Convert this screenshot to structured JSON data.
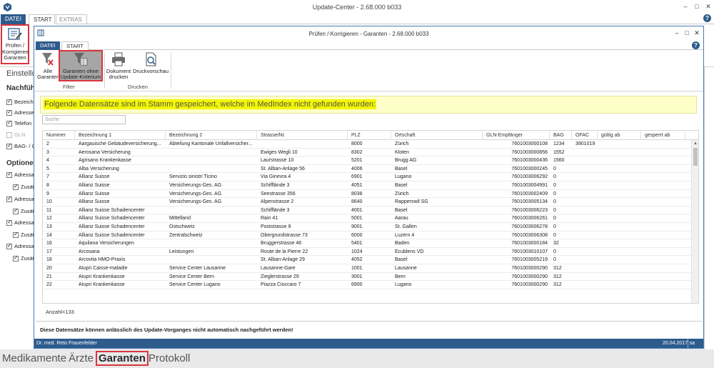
{
  "outer": {
    "title": "Update-Center - 2.68.000 b033",
    "tabs": [
      "DATEI",
      "START",
      "EXTRAS"
    ],
    "ribbon_button_label": "Prüfen / Korrigieren Garanten",
    "help": "?",
    "win_controls": [
      "–",
      "□",
      "✕"
    ]
  },
  "left_panel": {
    "heading1": "Einstellu",
    "heading2": "Nachfüh",
    "items1": [
      {
        "label": "Bezeichn",
        "checked": true,
        "disabled": false
      },
      {
        "label": "Adresse",
        "checked": true,
        "disabled": false
      },
      {
        "label": "Telefon",
        "checked": true,
        "disabled": false
      },
      {
        "label": "GLN",
        "checked": false,
        "disabled": true
      },
      {
        "label": "BAG- / C",
        "checked": true,
        "disabled": false
      }
    ],
    "heading3": "Optione",
    "items2": [
      {
        "label": "Adressal",
        "checked": true,
        "indent": false
      },
      {
        "label": "Zusät",
        "checked": true,
        "indent": true
      },
      {
        "label": "Adressal",
        "checked": true,
        "indent": false
      },
      {
        "label": "Zusät",
        "checked": true,
        "indent": true
      },
      {
        "label": "Adressal",
        "checked": true,
        "indent": false
      },
      {
        "label": "Zusät",
        "checked": true,
        "indent": true
      },
      {
        "label": "Adressal",
        "checked": true,
        "indent": false
      },
      {
        "label": "Zusät",
        "checked": true,
        "indent": true
      }
    ]
  },
  "dialog": {
    "title": "Prüfen / Korrigieren - Garanten - 2.68.000 b033",
    "tabs": [
      "DATEI",
      "START"
    ],
    "help": "?",
    "win_controls": [
      "–",
      "□",
      "✕"
    ],
    "ribbon": {
      "alle_garanten": "Alle Garanten",
      "ohne_update": "Garanten ohne Update-Kriterium",
      "dokument_drucken": "Dokument drucken",
      "druckvorschau": "Druckvorschau",
      "group_filter": "Filter",
      "group_drucken": "Drucken"
    },
    "notice": "Folgende Datensätze sind im Stamm gespeichert, welche im MedIndex nicht gefunden wurden:",
    "search_placeholder": "Suche",
    "columns": [
      "Nummer",
      "Bezeichnung 1",
      "Bezeichnung 2",
      "Strasse/Nr.",
      "PLZ",
      "Ortschaft",
      "GLN-Empfänger",
      "BAG",
      "OFAC",
      "gültig ab",
      "gesperrt ab"
    ],
    "rows": [
      [
        "2",
        "Aargauische Gebäudeversicherung...",
        "Abteilung Kantonale Unfallversicher...",
        "",
        "8000",
        "Zürich",
        "7601003000108",
        "1234",
        "3901019",
        "",
        ""
      ],
      [
        "3",
        "Aerosana Versicherung",
        "",
        "Ewiges Wegli 10",
        "8302",
        "Kloten",
        "7601003000856",
        "1552",
        "",
        "",
        ""
      ],
      [
        "4",
        "Agrisano Krankenkasse",
        "",
        "Laurstrasse 10",
        "5201",
        "Brugg AG",
        "7601003000436",
        "1560",
        "",
        "",
        ""
      ],
      [
        "5",
        "Alba Versicherung",
        "",
        "St. Alban-Anlage 56",
        "4006",
        "Basel",
        "7601003000245",
        "0",
        "",
        "",
        ""
      ],
      [
        "7",
        "Allianz Suisse",
        "Servizio sinistri Ticino",
        "Via Ginevra 4",
        "6901",
        "Lugano",
        "7601003006292",
        "0",
        "",
        "",
        ""
      ],
      [
        "8",
        "Allianz Suisse",
        "Versicherungs-Ges. AG",
        "Schifflände 3",
        "4051",
        "Basel",
        "7601003004991",
        "0",
        "",
        "",
        ""
      ],
      [
        "9",
        "Allianz Suisse",
        "Versicherungs-Ges. AG",
        "Seestrasse 356",
        "8038",
        "Zürich",
        "7601003002409",
        "0",
        "",
        "",
        ""
      ],
      [
        "10",
        "Allianz Suisse",
        "Versicherungs-Ges. AG",
        "Alpenstrasse 2",
        "8640",
        "Rapperswil SG",
        "7601003005134",
        "0",
        "",
        "",
        ""
      ],
      [
        "11",
        "Allianz Suisse Schadencenter",
        "",
        "Schifflände 3",
        "4001",
        "Basel",
        "7601003006223",
        "0",
        "",
        "",
        ""
      ],
      [
        "12",
        "Allianz Suisse Schadencenter",
        "Mittelland",
        "Rain 41",
        "5001",
        "Aarau",
        "7601003006261",
        "0",
        "",
        "",
        ""
      ],
      [
        "13",
        "Allianz Suisse Schadencenter",
        "Ostschweiz",
        "Poststrasse 9",
        "9001",
        "St. Gallen",
        "7601003006278",
        "0",
        "",
        "",
        ""
      ],
      [
        "14",
        "Allianz Suisse Schadencenter",
        "Zentralschweiz",
        "Obergrundstrasse 73",
        "6000",
        "Luzern 4",
        "7601003006308",
        "0",
        "",
        "",
        ""
      ],
      [
        "16",
        "Aquilana Versicherungen",
        "",
        "Bruggerstrasse 46",
        "5401",
        "Baden",
        "7601003000184",
        "32",
        "",
        "",
        ""
      ],
      [
        "17",
        "Arcosana",
        "Leistungen",
        "Route de la Pierre 22",
        "1024",
        "Ecublens VD",
        "7601003010107",
        "0",
        "",
        "",
        ""
      ],
      [
        "18",
        "Arcovita HMO-Praxis",
        "",
        "St. Alban-Anlage 29",
        "4052",
        "Basel",
        "7601003005219",
        "0",
        "",
        "",
        ""
      ],
      [
        "20",
        "Atupri Caisse-maladie",
        "Service Center Lausanne",
        "Lausanne-Gare",
        "1001",
        "Lausanne",
        "7601003000290",
        "312",
        "",
        "",
        ""
      ],
      [
        "21",
        "Atupri Krankenkasse",
        "Service Center Bern",
        "Zieglerstrasse 29",
        "3001",
        "Bern",
        "7601003000290",
        "312",
        "",
        "",
        ""
      ],
      [
        "22",
        "Atupri Krankenkasse",
        "Service Center Lugano",
        "Piazza Cioccaro 7",
        "6900",
        "Lugano",
        "7601003000290",
        "312",
        "",
        "",
        ""
      ]
    ],
    "count": "Anzahl=133",
    "footnote": "Diese Datensätze können anlässlich des Update-Vorganges nicht automatisch nachgeführt werden!",
    "status_user": "Dr. med. Reto Frauenfelder",
    "status_date": "20.04.2017",
    "status_login": "sa"
  },
  "bottom_nav": [
    "Medikamente",
    "Ärzte",
    "Garanten",
    "Protokoll"
  ],
  "colors": {
    "accent": "#2d5b8c",
    "highlight_border": "#d9363e",
    "notice_bg": "#feffc8",
    "notice_mark": "#f3f600"
  }
}
